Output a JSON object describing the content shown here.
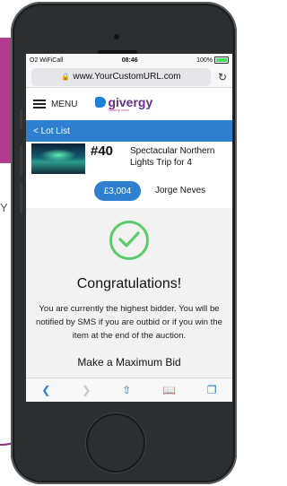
{
  "background": {
    "side_letter": "Y"
  },
  "status_bar": {
    "carrier": "O2 WiFiCall",
    "time": "08:46",
    "battery": "100%"
  },
  "browser": {
    "url": "www.YourCustomURL.com"
  },
  "site_header": {
    "menu_label": "MENU",
    "logo_text": "givergy",
    "logo_tagline": "Raising more"
  },
  "nav": {
    "back_label": "< Lot List"
  },
  "lot": {
    "number": "#40",
    "title": "Spectacular Northern Lights Trip for 4",
    "current_bid": "£3,004",
    "bidder": "Jorge Neves"
  },
  "confirmation": {
    "heading": "Congratulations!",
    "message": "You are currently the highest bidder. You will be notified by SMS if you are outbid or if you win the item at the end of the auction.",
    "next_section": "Make a Maximum Bid"
  },
  "colors": {
    "accent": "#2f7fd0",
    "success": "#5ccb6b",
    "brand_purple": "#6b2c8f"
  }
}
